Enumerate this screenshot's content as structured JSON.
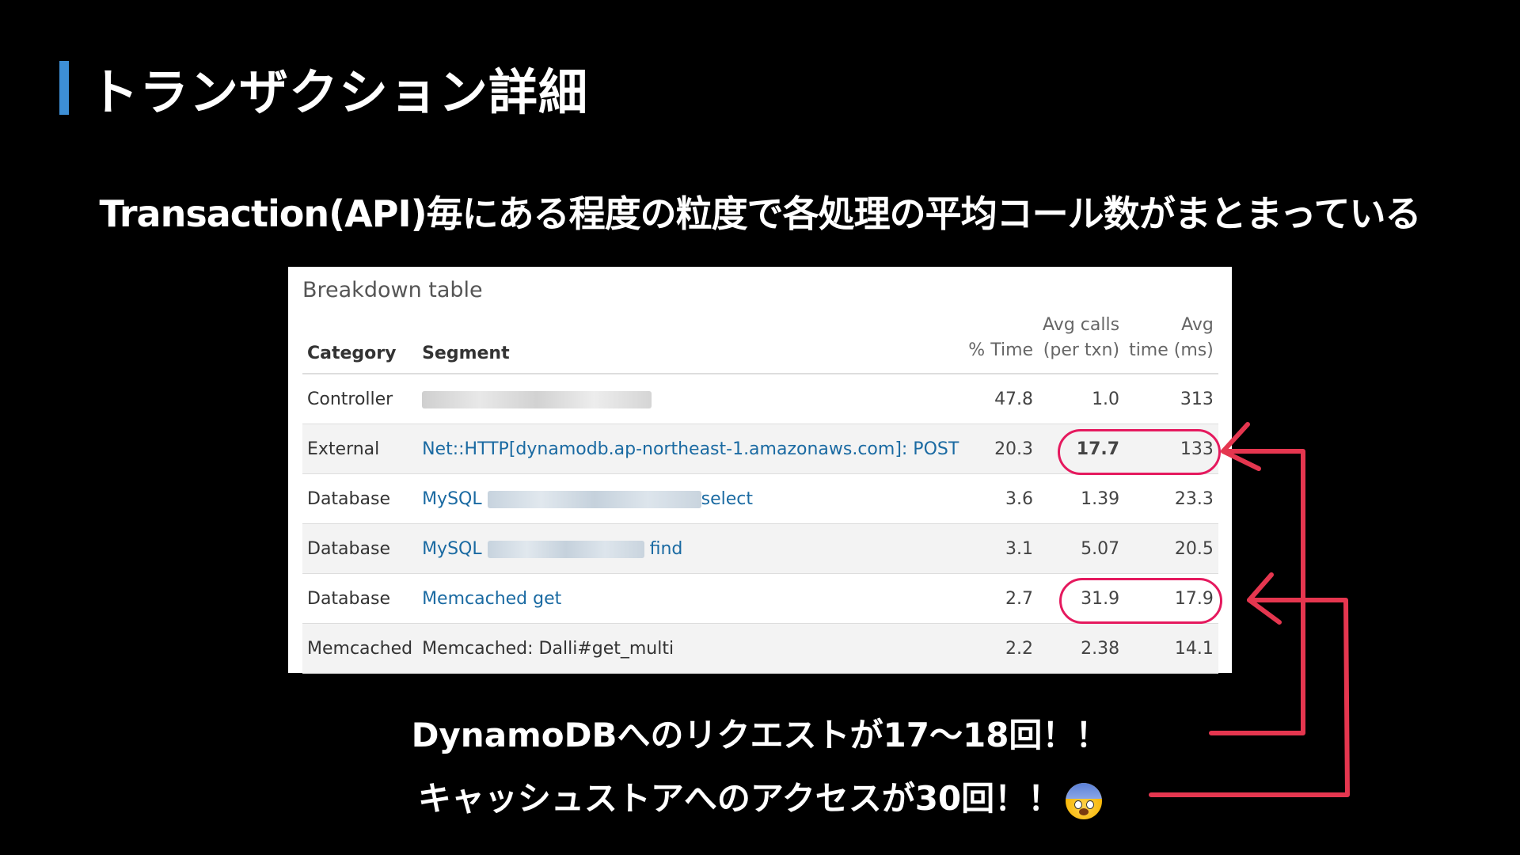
{
  "slide": {
    "title": "トランザクション詳細",
    "subtitle": "Transaction(API)毎にある程度の粒度で各処理の平均コール数がまとまっている",
    "note_line1": "DynamoDBへのリクエストが17〜18回！！",
    "note_line2": "キャッシュストアへのアクセスが30回！！",
    "emoji": "fearful-face-icon",
    "accent_color": "#3d8fd6",
    "annotation_color": "#e5195e"
  },
  "table": {
    "title": "Breakdown table",
    "headers": {
      "category": "Category",
      "segment": "Segment",
      "time_pct": "% Time",
      "avg_calls_1": "Avg calls",
      "avg_calls_2": "(per txn)",
      "avg_time_1": "Avg",
      "avg_time_2": "time (ms)"
    },
    "rows": [
      {
        "category": "Controller",
        "segment_prefix": "",
        "segment_suffix": "",
        "time_pct": "47.8",
        "avg_calls": "1.0",
        "avg_time": "313"
      },
      {
        "category": "External",
        "segment_prefix": "Net::HTTP[dynamodb.ap-northeast-1.amazonaws.com]: POST",
        "segment_suffix": "",
        "time_pct": "20.3",
        "avg_calls": "17.7",
        "avg_time": "133"
      },
      {
        "category": "Database",
        "segment_prefix": "MySQL",
        "segment_suffix": "select",
        "time_pct": "3.6",
        "avg_calls": "1.39",
        "avg_time": "23.3"
      },
      {
        "category": "Database",
        "segment_prefix": "MySQL",
        "segment_suffix": "find",
        "time_pct": "3.1",
        "avg_calls": "5.07",
        "avg_time": "20.5"
      },
      {
        "category": "Database",
        "segment_prefix": "Memcached get",
        "segment_suffix": "",
        "time_pct": "2.7",
        "avg_calls": "31.9",
        "avg_time": "17.9"
      },
      {
        "category": "Memcached",
        "segment_prefix": "Memcached: Dalli#get_multi",
        "segment_suffix": "",
        "time_pct": "2.2",
        "avg_calls": "2.38",
        "avg_time": "14.1"
      }
    ]
  }
}
